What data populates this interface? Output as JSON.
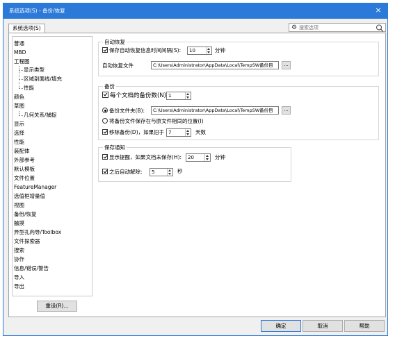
{
  "window": {
    "title": "系统选项(S) - 备份/恢复",
    "close_label": "×"
  },
  "tabs": [
    {
      "label": "系统选项(S)"
    }
  ],
  "search": {
    "placeholder": "搜索选项"
  },
  "tree": {
    "items": [
      {
        "label": "普通",
        "child": false
      },
      {
        "label": "MBD",
        "child": false
      },
      {
        "label": "工程图",
        "child": false
      },
      {
        "label": "显示类型",
        "child": true
      },
      {
        "label": "区域剖面线/填充",
        "child": true
      },
      {
        "label": "性能",
        "child": true
      },
      {
        "label": "颜色",
        "child": false
      },
      {
        "label": "草图",
        "child": false
      },
      {
        "label": "几何关系/捕捉",
        "child": true
      },
      {
        "label": "显示",
        "child": false
      },
      {
        "label": "选择",
        "child": false
      },
      {
        "label": "性能",
        "child": false
      },
      {
        "label": "装配体",
        "child": false
      },
      {
        "label": "外部参考",
        "child": false
      },
      {
        "label": "默认模板",
        "child": false
      },
      {
        "label": "文件位置",
        "child": false
      },
      {
        "label": "FeatureManager",
        "child": false
      },
      {
        "label": "选值框增量值",
        "child": false
      },
      {
        "label": "视图",
        "child": false
      },
      {
        "label": "备份/恢复",
        "child": false
      },
      {
        "label": "触摸",
        "child": false
      },
      {
        "label": "异型孔向导/Toolbox",
        "child": false
      },
      {
        "label": "文件探索器",
        "child": false
      },
      {
        "label": "搜索",
        "child": false
      },
      {
        "label": "协作",
        "child": false
      },
      {
        "label": "信息/错误/警告",
        "child": false
      },
      {
        "label": "导入",
        "child": false
      },
      {
        "label": "导出",
        "child": false
      }
    ],
    "reset_label": "重设(R)..."
  },
  "autorecover": {
    "title": "自动恢复",
    "save_info_label": "保存自动恢复信息时间间隔(S):",
    "interval_value": "10",
    "interval_unit": "分钟",
    "file_label": "自动恢复文件",
    "file_path": "C:\\Users\\Administrator\\AppData\\Local\\TempSW备份目",
    "browse_label": "..."
  },
  "backup": {
    "title": "备份",
    "copies_label": "每个文档的备份数(N):",
    "copies_value": "1",
    "folder_label": "备份文件夹(B):",
    "folder_path": "C:\\Users\\Administrator\\AppData\\Local\\TempSW备份目",
    "browse_label": "...",
    "same_location_label": "将备份文件保存在与原文件相同的位置(I)",
    "delete_label": "移除备份(D)，如果旧于",
    "delete_value": "7",
    "delete_unit": "天数"
  },
  "save_notify": {
    "title": "保存通知",
    "remind_label": "显示提醒，如果文档未保存(H):",
    "remind_value": "20",
    "remind_unit": "分钟",
    "dismiss_label": "之后自动解除:",
    "dismiss_value": "5",
    "dismiss_unit": "秒"
  },
  "footer": {
    "ok_label": "确定",
    "cancel_label": "取消",
    "help_label": "帮助"
  }
}
